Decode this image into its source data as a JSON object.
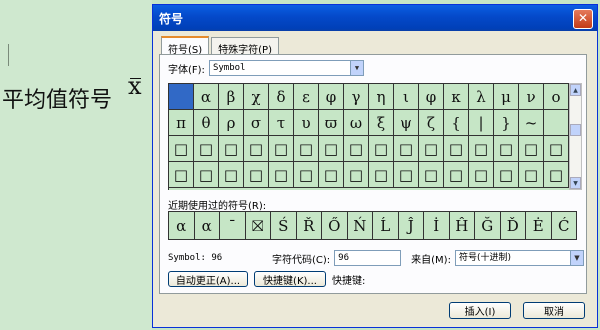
{
  "document": {
    "text": "平均值符号",
    "symbol": "x"
  },
  "dialog": {
    "title": "符号",
    "close_label": "✕",
    "tabs": [
      "符号(S)",
      "特殊字符(P)"
    ],
    "font_label": "字体(F):",
    "font_value": "Symbol",
    "grid": [
      [
        "",
        "α",
        "β",
        "χ",
        "δ",
        "ε",
        "φ",
        "γ",
        "η",
        "ι",
        "φ",
        "κ",
        "λ",
        "μ",
        "ν",
        "ο"
      ],
      [
        "π",
        "θ",
        "ρ",
        "σ",
        "τ",
        "υ",
        "ϖ",
        "ω",
        "ξ",
        "ψ",
        "ζ",
        "{",
        "|",
        "}",
        "~",
        ""
      ],
      [
        "□",
        "□",
        "□",
        "□",
        "□",
        "□",
        "□",
        "□",
        "□",
        "□",
        "□",
        "□",
        "□",
        "□",
        "□",
        "□"
      ],
      [
        "□",
        "□",
        "□",
        "□",
        "□",
        "□",
        "□",
        "□",
        "□",
        "□",
        "□",
        "□",
        "□",
        "□",
        "□",
        "□"
      ]
    ],
    "recent_label": "近期使用过的符号(R):",
    "recent": [
      "α",
      "α",
      "¯",
      "⛝",
      "Ś",
      "Ř",
      "Ő",
      "Ń",
      "Ĺ",
      "Ĵ",
      "İ",
      "Ĥ",
      "Ğ",
      "Ď",
      "Ė",
      "Ć"
    ],
    "symbol_info": "Symbol: 96",
    "code_label": "字符代码(C):",
    "code_value": "96",
    "from_label": "来自(M):",
    "from_value": "符号(十进制)",
    "autocorrect_label": "自动更正(A)...",
    "shortcut_btn_label": "快捷键(K)...",
    "shortcut_label": "快捷键:",
    "insert_label": "插入(I)",
    "cancel_label": "取消"
  }
}
